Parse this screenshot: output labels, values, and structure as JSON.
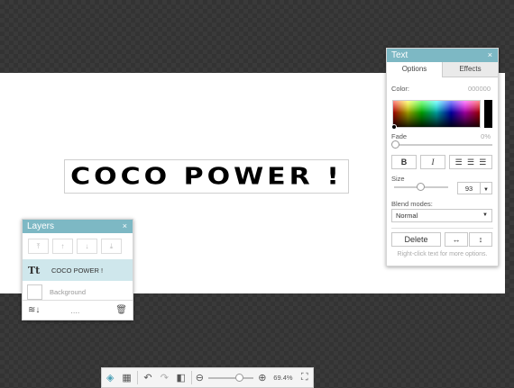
{
  "canvas": {
    "text": "COCO POWER !"
  },
  "text_panel": {
    "title": "Text",
    "close": "×",
    "tabs": [
      "Options",
      "Effects"
    ],
    "color_label": "Color:",
    "color_value": "000000",
    "fade_label": "Fade",
    "fade_value": "0%",
    "bold_label": "B",
    "italic_label": "I",
    "size_label": "Size",
    "size_value": "93",
    "blend_label": "Blend modes:",
    "blend_value": "Normal",
    "delete_label": "Delete",
    "hint": "Right-click text for more options.",
    "selected_color": "#000000",
    "header_color": "#7db8c4"
  },
  "layers_panel": {
    "title": "Layers",
    "close": "×",
    "layers": [
      {
        "thumb": "Tt",
        "name": "COCO POWER !"
      },
      {
        "name": "Background"
      }
    ],
    "more": "....",
    "selected_row_color": "#cfe7ec"
  },
  "toolbar": {
    "zoom_text": "69.4%",
    "zoom_level": 0.55
  }
}
